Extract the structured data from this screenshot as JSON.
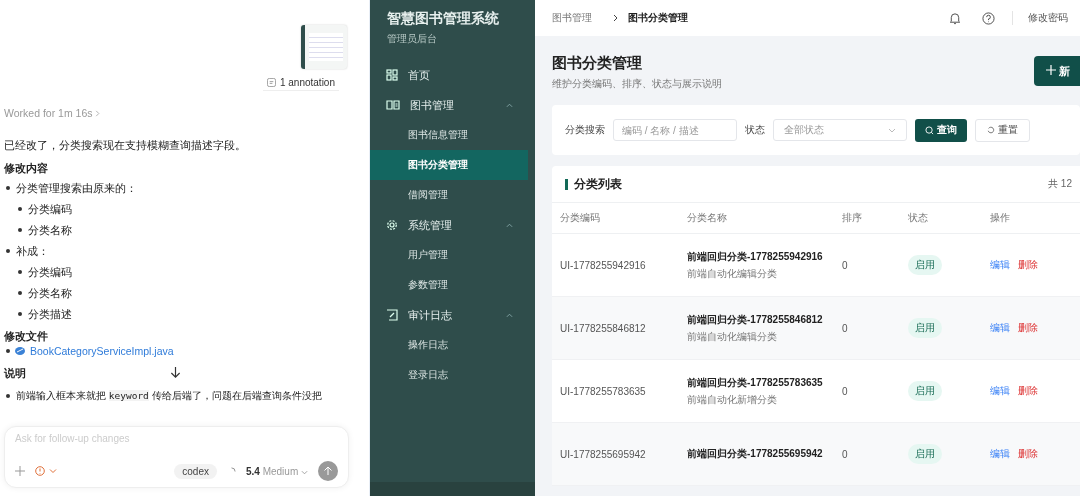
{
  "chat": {
    "attachment_label": "1 annotation",
    "worked": "Worked for 1m 16s",
    "blocks": [
      {
        "kind": "paragraph",
        "text": "已经改了，分类搜索现在支持模糊查询描述字段。"
      },
      {
        "kind": "heading",
        "text": "修改内容"
      },
      {
        "kind": "bullet",
        "text": "分类管理搜索由原来的：",
        "children": [
          {
            "text": "分类编码"
          },
          {
            "text": "分类名称"
          }
        ]
      },
      {
        "kind": "bullet",
        "text": "补成：",
        "children": [
          {
            "text": "分类编码"
          },
          {
            "text": "分类名称"
          },
          {
            "text": "分类描述"
          }
        ]
      },
      {
        "kind": "heading",
        "text": "修改文件"
      },
      {
        "kind": "file",
        "text": "BookCategoryServiceImpl.java"
      },
      {
        "kind": "heading",
        "text": "说明"
      },
      {
        "kind": "code_bullet",
        "before": "前端输入框本来就把",
        "code": "keyword",
        "after": "传给后端了，问题在后端查询条件没把"
      }
    ],
    "composer": {
      "placeholder": "Ask for follow-up changes",
      "agent": "codex",
      "version": "5.4",
      "effort": "Medium"
    }
  },
  "sidebar": {
    "title": "智慧图书管理系统",
    "subtitle": "管理员后台",
    "items": [
      {
        "kind": "grid",
        "label": "首页"
      },
      {
        "kind": "book",
        "label": "图书管理",
        "expanded": true,
        "children": [
          {
            "label": "图书信息管理",
            "selected": false
          },
          {
            "label": "图书分类管理",
            "selected": true
          },
          {
            "label": "借阅管理",
            "selected": false
          }
        ]
      },
      {
        "kind": "gear",
        "label": "系统管理",
        "expanded": true,
        "children": [
          {
            "label": "用户管理",
            "selected": false
          },
          {
            "label": "参数管理",
            "selected": false
          }
        ]
      },
      {
        "kind": "log",
        "label": "审计日志",
        "expanded": true,
        "children": [
          {
            "label": "操作日志",
            "selected": false
          },
          {
            "label": "登录日志",
            "selected": false
          }
        ]
      }
    ]
  },
  "topbar": {
    "breadcrumb": [
      "图书管理",
      "图书分类管理"
    ],
    "change_password": "修改密码"
  },
  "page": {
    "title": "图书分类管理",
    "subtitle": "维护分类编码、排序、状态与展示说明",
    "add_button": "新"
  },
  "filter": {
    "search_label": "分类搜索",
    "search_placeholder": "编码 / 名称 / 描述",
    "status_label": "状态",
    "status_placeholder": "全部状态",
    "query_button": "查询",
    "reset_button": "重置"
  },
  "table": {
    "title": "分类列表",
    "count": "共 12",
    "columns": [
      "分类编码",
      "分类名称",
      "排序",
      "状态",
      "操作"
    ],
    "rows": [
      {
        "code": "UI-1778255942916",
        "name": "前端回归分类-1778255942916",
        "description": "前端自动化编辑分类",
        "sort": "0",
        "status": "启用",
        "enabled": true,
        "edit": "编辑",
        "delete": "删除"
      },
      {
        "code": "UI-1778255846812",
        "name": "前端回归分类-1778255846812",
        "description": "前端自动化编辑分类",
        "sort": "0",
        "status": "启用",
        "enabled": true,
        "edit": "编辑",
        "delete": "删除"
      },
      {
        "code": "UI-1778255783635",
        "name": "前端回归分类-1778255783635",
        "description": "前端自动化新增分类",
        "sort": "0",
        "status": "启用",
        "enabled": true,
        "edit": "编辑",
        "delete": "删除"
      },
      {
        "code": "UI-1778255695942",
        "name": "前端回归分类-1778255695942",
        "sort": "0",
        "status": "启用",
        "enabled": true,
        "edit": "编辑",
        "delete": "删除"
      }
    ]
  }
}
